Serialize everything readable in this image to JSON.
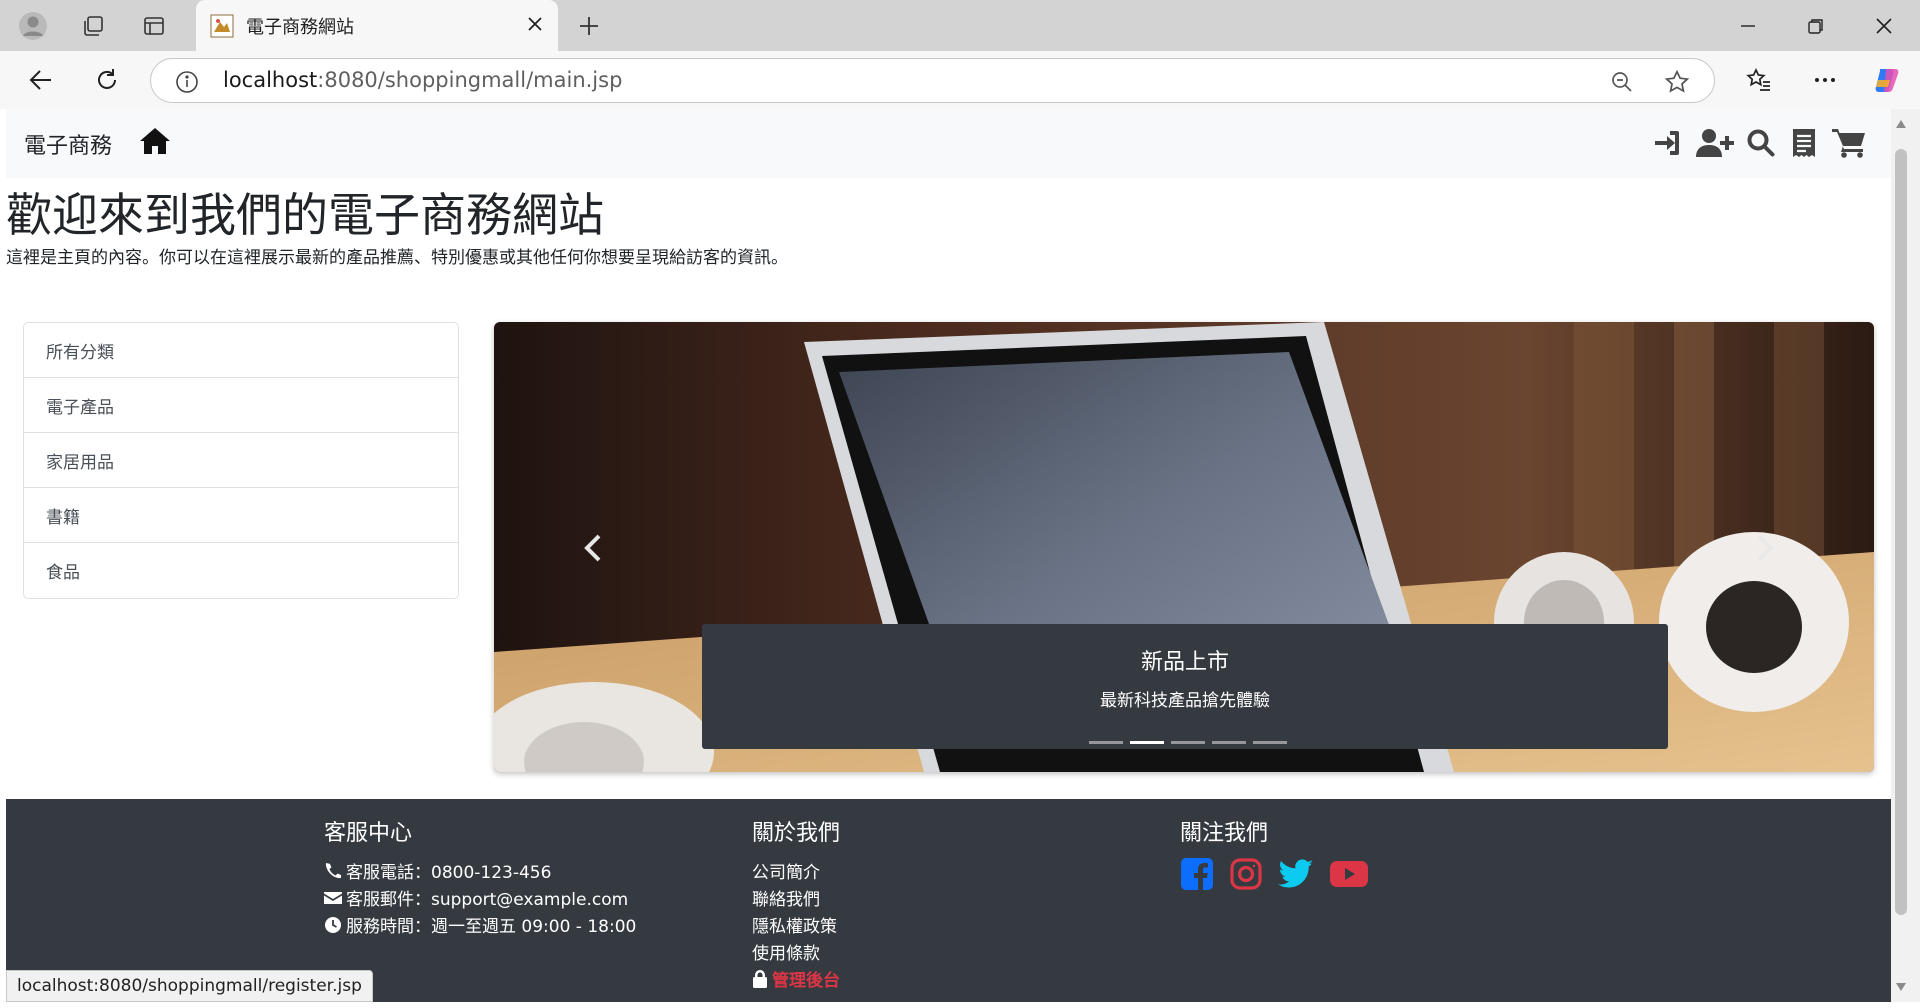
{
  "browser": {
    "tab_title": "電子商務網站",
    "url_host": "localhost",
    "url_rest": ":8080/shoppingmall/main.jsp",
    "status_url": "localhost:8080/shoppingmall/register.jsp"
  },
  "nav": {
    "brand": "電子商務",
    "icons": [
      "home-icon",
      "login-icon",
      "user-plus-icon",
      "search-icon",
      "receipt-icon",
      "cart-icon"
    ]
  },
  "hero": {
    "title": "歡迎來到我們的電子商務網站",
    "lead": "這裡是主頁的內容。你可以在這裡展示最新的產品推薦、特別優惠或其他任何你想要呈現給訪客的資訊。"
  },
  "categories": [
    "所有分類",
    "電子產品",
    "家居用品",
    "書籍",
    "食品"
  ],
  "carousel": {
    "caption_title": "新品上市",
    "caption_text": "最新科技產品搶先體驗",
    "slide_count": 5,
    "active_index": 1
  },
  "footer": {
    "service": {
      "title": "客服中心",
      "phone": "客服電話：0800-123-456",
      "email": "客服郵件：support@example.com",
      "hours": "服務時間：週一至週五 09:00 - 18:00"
    },
    "about": {
      "title": "關於我們",
      "links": [
        "公司簡介",
        "聯絡我們",
        "隱私權政策",
        "使用條款"
      ],
      "admin": "管理後台"
    },
    "follow": {
      "title": "關注我們",
      "socials": [
        "facebook-icon",
        "instagram-icon",
        "twitter-icon",
        "youtube-icon"
      ]
    }
  },
  "colors": {
    "footer_bg": "#343a40",
    "navbar_bg": "#f8f9fa",
    "admin_red": "#dc3545",
    "facebook": "#0d6efd",
    "instagram": "#dc3545",
    "twitter": "#0dcaf0",
    "youtube": "#dc3545"
  }
}
